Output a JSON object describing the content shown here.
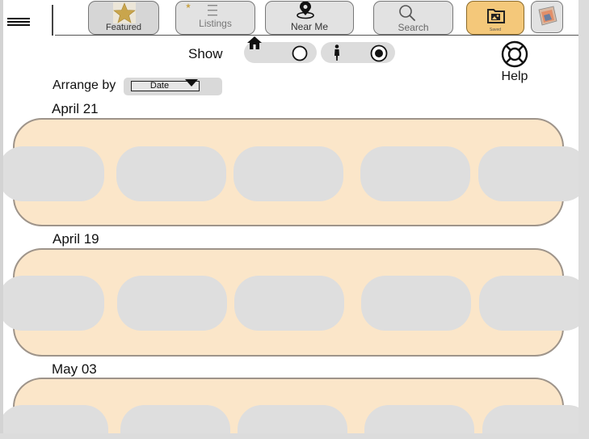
{
  "nav": {
    "featured": {
      "label": "Featured",
      "icon": "star-icon"
    },
    "listings": {
      "label": "Listings",
      "icon": "list-icon"
    },
    "near_me": {
      "label": "Near Me",
      "icon": "location-pin-icon"
    },
    "search": {
      "label": "Search",
      "icon": "search-icon"
    },
    "saved": {
      "label": "Saved",
      "icon": "saved-folder-icon"
    },
    "profile": {
      "icon": "profile-image-icon"
    }
  },
  "filters": {
    "show_label": "Show",
    "options": [
      {
        "icon": "home-icon",
        "selected": false
      },
      {
        "icon": "person-icon",
        "selected": true
      }
    ]
  },
  "help": {
    "label": "Help",
    "icon": "lifebuoy-icon"
  },
  "arrange": {
    "label": "Arrange by",
    "value": "Date"
  },
  "groups": [
    {
      "date": "April 21"
    },
    {
      "date": "April 19"
    },
    {
      "date": "May 03"
    }
  ],
  "colors": {
    "row_fill": "#fbe6c9",
    "row_border": "#9e948a",
    "card_fill": "#dedede",
    "saved_accent": "#f4c87a",
    "star_gold": "#c9a54c"
  }
}
